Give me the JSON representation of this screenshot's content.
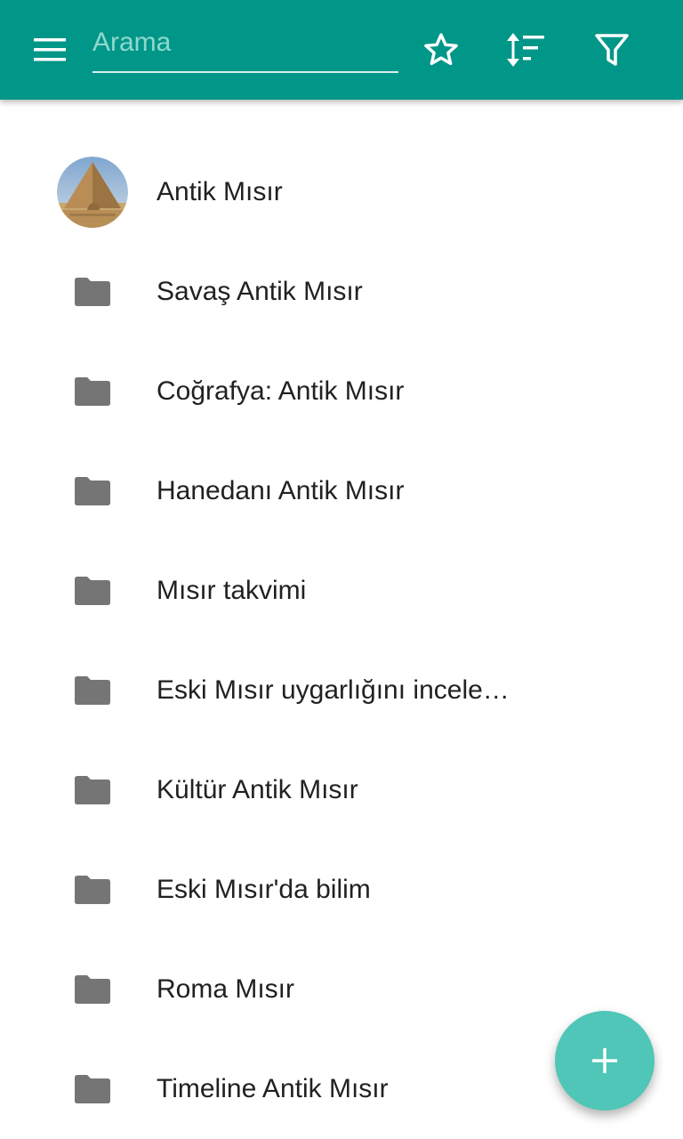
{
  "toolbar": {
    "search_placeholder": "Arama",
    "background_color": "#009688",
    "menu_icon": "menu-icon",
    "favorite_icon": "star-outline-icon",
    "sort_icon": "sort-icon",
    "filter_icon": "filter-icon"
  },
  "list": {
    "items": [
      {
        "label": "Antik Mısır",
        "icon": "pyramid-avatar"
      },
      {
        "label": "Savaş Antik Mısır",
        "icon": "folder-icon"
      },
      {
        "label": "Coğrafya: Antik Mısır",
        "icon": "folder-icon"
      },
      {
        "label": "Hanedanı Antik Mısır",
        "icon": "folder-icon"
      },
      {
        "label": "Mısır takvimi",
        "icon": "folder-icon"
      },
      {
        "label": "Eski Mısır uygarlığını incele…",
        "icon": "folder-icon"
      },
      {
        "label": "Kültür Antik Mısır",
        "icon": "folder-icon"
      },
      {
        "label": "Eski Mısır'da bilim",
        "icon": "folder-icon"
      },
      {
        "label": "Roma Mısır",
        "icon": "folder-icon"
      },
      {
        "label": "Timeline Antik Mısır",
        "icon": "folder-icon"
      }
    ]
  },
  "fab": {
    "icon": "plus-icon",
    "color": "#4fc6b7"
  }
}
